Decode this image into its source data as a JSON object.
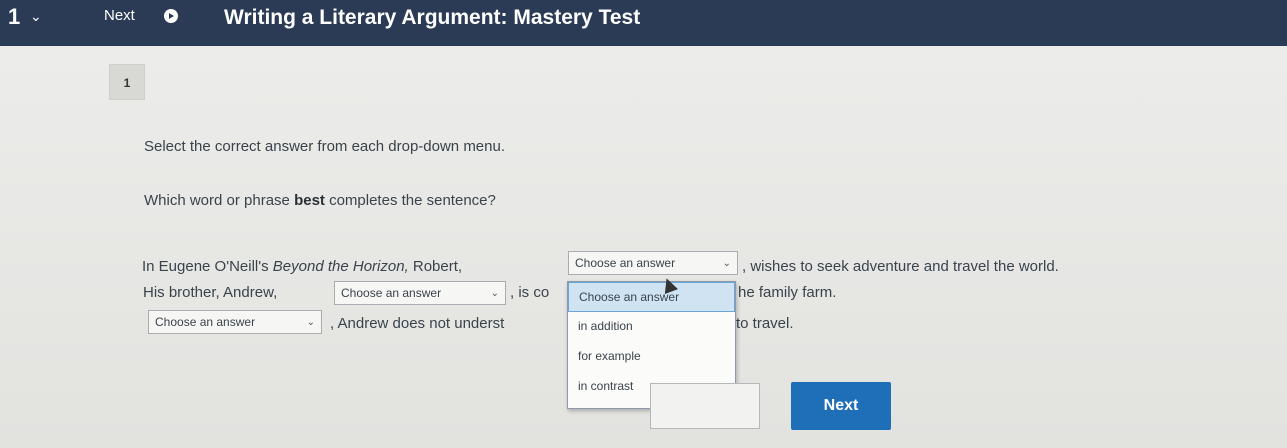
{
  "header": {
    "brand_number": "1",
    "next_label": "Next",
    "title": "Writing a Literary Argument: Mastery Test"
  },
  "question": {
    "number": "1",
    "instruction": "Select the correct answer from each drop-down menu.",
    "prompt_before": "Which word or phrase ",
    "prompt_bold": "best",
    "prompt_after": " completes the sentence?"
  },
  "sentence": {
    "l1_before": "In Eugene O'Neill's ",
    "l1_italic": "Beyond the Horizon,",
    "l1_mid": " Robert,",
    "l1_after": ", wishes to seek adventure and travel the world.",
    "l2_before": "His brother, Andrew,",
    "l2_mid": ", is co",
    "l2_after": "he family farm.",
    "l3_before": ", Andrew does not underst",
    "l3_after": "to travel."
  },
  "select_placeholder": "Choose an answer",
  "dropdown": {
    "options": [
      "Choose an answer",
      "in addition",
      "for example",
      "in contrast"
    ]
  },
  "footer": {
    "next_button": "Next"
  }
}
